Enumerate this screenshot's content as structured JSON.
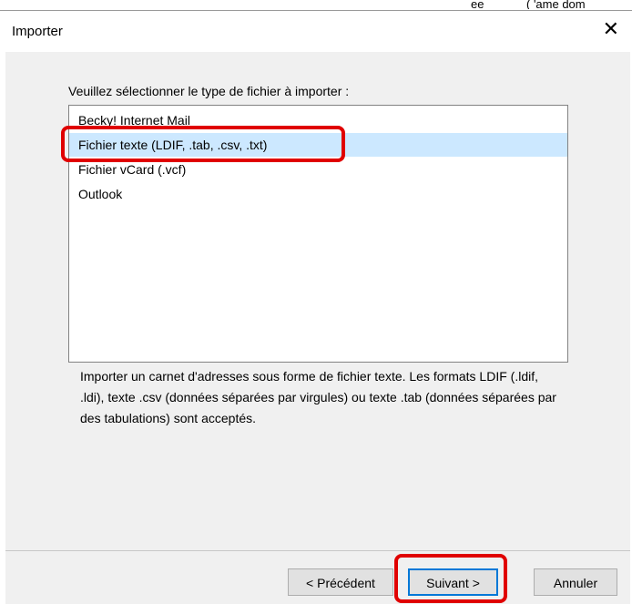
{
  "top_clip": {
    "left": "ee",
    "right": "( 'ame dom"
  },
  "dialog": {
    "title": "Importer",
    "close_glyph": "✕"
  },
  "prompt": "Veuillez sélectionner le type de fichier à importer :",
  "file_types": [
    {
      "label": "Becky! Internet Mail",
      "selected": false
    },
    {
      "label": "Fichier texte (LDIF, .tab, .csv, .txt)",
      "selected": true
    },
    {
      "label": "Fichier vCard (.vcf)",
      "selected": false
    },
    {
      "label": "Outlook",
      "selected": false
    }
  ],
  "description": "Importer un carnet d'adresses sous forme de fichier texte. Les formats LDIF (.ldif, .ldi), texte .csv (données séparées par virgules) ou texte .tab (données séparées par des tabulations) sont acceptés.",
  "buttons": {
    "previous": "< Précédent",
    "next": "Suivant >",
    "cancel": "Annuler"
  },
  "colors": {
    "selection": "#cce8ff",
    "annotation": "#e00000",
    "default_button_border": "#0078d7",
    "dialog_background": "#f0f0f0"
  }
}
